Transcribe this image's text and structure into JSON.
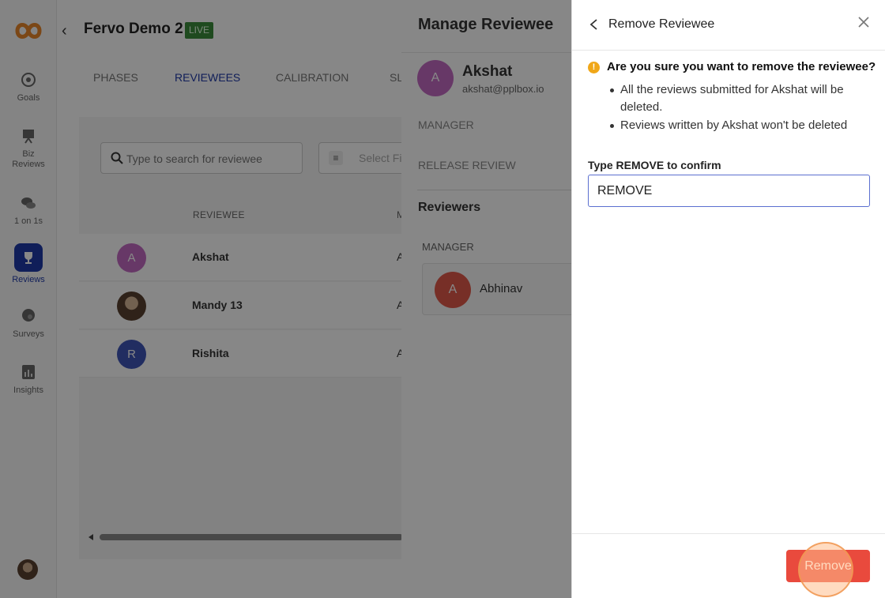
{
  "app": {
    "title": "Fervo Demo 2",
    "status_badge": "LIVE"
  },
  "sidebar": {
    "items": [
      {
        "label": "Goals",
        "icon": "goals-icon"
      },
      {
        "label": "Biz Reviews",
        "icon": "biz-reviews-icon"
      },
      {
        "label": "1 on 1s",
        "icon": "one-on-one-icon"
      },
      {
        "label": "Reviews",
        "icon": "trophy-icon",
        "active": true
      },
      {
        "label": "Surveys",
        "icon": "surveys-icon"
      },
      {
        "label": "Insights",
        "icon": "insights-icon"
      }
    ]
  },
  "tabs": [
    {
      "label": "PHASES"
    },
    {
      "label": "REVIEWEES",
      "active": true
    },
    {
      "label": "CALIBRATION"
    },
    {
      "label": "SL"
    }
  ],
  "search": {
    "placeholder": "Type to search for reviewee",
    "value": ""
  },
  "filter": {
    "placeholder": "Select Fi"
  },
  "table": {
    "columns": [
      "REVIEWEE",
      "M"
    ],
    "rows": [
      {
        "initial": "A",
        "name": "Akshat",
        "manager_initial": "A",
        "avatar_color": "#c36bc3"
      },
      {
        "initial": "",
        "name": "Mandy 13",
        "manager_initial": "A",
        "avatar_color": "#8a6a50"
      },
      {
        "initial": "R",
        "name": "Rishita",
        "manager_initial": "A",
        "avatar_color": "#3f55b8"
      }
    ]
  },
  "manage_panel": {
    "title": "Manage Reviewee",
    "reviewee": {
      "initial": "A",
      "name": "Akshat",
      "email": "akshat@pplbox.io"
    },
    "manager_label": "MANAGER",
    "release_label": "RELEASE REVIEW",
    "reviewers_heading": "Reviewers",
    "reviewer_group_label": "MANAGER",
    "reviewer": {
      "initial": "A",
      "name": "Abhinav"
    }
  },
  "drawer": {
    "title": "Remove Reviewee",
    "warning_question": "Are you sure you want to remove the reviewee?",
    "bullets": [
      "All the reviews submitted for Akshat will be deleted.",
      "Reviews written by Akshat won't be deleted"
    ],
    "confirm_label": "Type REMOVE to confirm",
    "confirm_value": "REMOVE",
    "remove_button": "Remove"
  },
  "colors": {
    "accent": "#1f3aa8",
    "danger": "#e94a3d",
    "warning": "#f0a718",
    "live": "#3c8c3c"
  }
}
